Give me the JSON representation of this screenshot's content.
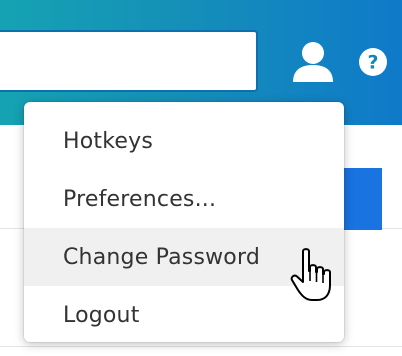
{
  "search": {
    "value": "",
    "placeholder": ""
  },
  "header": {
    "user_icon": "user-icon",
    "help_icon": "help-icon",
    "help_glyph": "?"
  },
  "menu": {
    "items": [
      {
        "label": "Hotkeys"
      },
      {
        "label": "Preferences..."
      },
      {
        "label": "Change Password"
      },
      {
        "label": "Logout"
      }
    ],
    "hovered_index": 2
  },
  "colors": {
    "header_start": "#15a3b3",
    "header_end": "#0f7ac9",
    "accent_button": "#1973e0",
    "menu_hover": "#f0f0f0"
  },
  "cursor": {
    "type": "hand-pointer"
  }
}
